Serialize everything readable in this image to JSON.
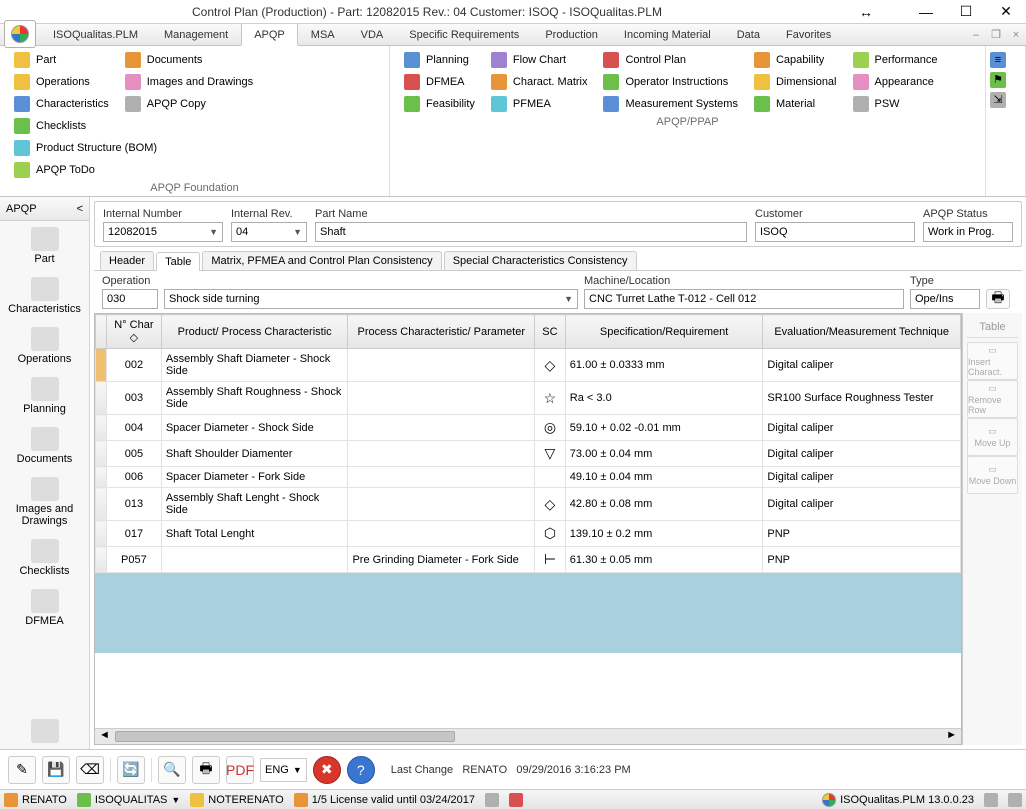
{
  "title": "Control Plan (Production) - Part: 12082015 Rev.: 04 Customer: ISOQ - ISOQualitas.PLM",
  "menu": {
    "tabs": [
      "ISOQualitas.PLM",
      "Management",
      "APQP",
      "MSA",
      "VDA",
      "Specific Requirements",
      "Production",
      "Incoming Material",
      "Data",
      "Favorites"
    ],
    "active": "APQP"
  },
  "ribbon": {
    "group1": {
      "label": "APQP Foundation",
      "col1": [
        {
          "icon": "gear",
          "label": "Part"
        },
        {
          "icon": "gear",
          "label": "Operations"
        },
        {
          "icon": "list",
          "label": "Characteristics"
        }
      ],
      "col2": [
        {
          "icon": "folder",
          "label": "Documents"
        },
        {
          "icon": "image",
          "label": "Images and Drawings"
        },
        {
          "icon": "copy",
          "label": "APQP Copy"
        }
      ],
      "col3": [
        {
          "icon": "check",
          "label": "Checklists"
        },
        {
          "icon": "tree",
          "label": "Product Structure (BOM)"
        },
        {
          "icon": "todo",
          "label": "APQP ToDo"
        }
      ]
    },
    "group2": {
      "label": "APQP/PPAP",
      "col1": [
        {
          "icon": "plan",
          "label": "Planning"
        },
        {
          "icon": "dfmea",
          "label": "DFMEA"
        },
        {
          "icon": "feas",
          "label": "Feasibility"
        }
      ],
      "col2": [
        {
          "icon": "flow",
          "label": "Flow Chart"
        },
        {
          "icon": "cm",
          "label": "Charact. Matrix"
        },
        {
          "icon": "pfmea",
          "label": "PFMEA"
        }
      ],
      "col3": [
        {
          "icon": "cp",
          "label": "Control Plan"
        },
        {
          "icon": "oi",
          "label": "Operator Instructions"
        },
        {
          "icon": "ms",
          "label": "Measurement Systems"
        }
      ],
      "col4": [
        {
          "icon": "cap",
          "label": "Capability"
        },
        {
          "icon": "dim",
          "label": "Dimensional"
        },
        {
          "icon": "mat",
          "label": "Material"
        }
      ],
      "col5": [
        {
          "icon": "perf",
          "label": "Performance"
        },
        {
          "icon": "app",
          "label": "Appearance"
        },
        {
          "icon": "psw",
          "label": "PSW"
        }
      ]
    }
  },
  "left_strip": {
    "header": "APQP",
    "items": [
      "Part",
      "Characteristics",
      "Operations",
      "Planning",
      "Documents",
      "Images and Drawings",
      "Checklists",
      "DFMEA"
    ]
  },
  "fields": {
    "internal_number": {
      "label": "Internal Number",
      "value": "12082015"
    },
    "internal_rev": {
      "label": "Internal Rev.",
      "value": "04"
    },
    "part_name": {
      "label": "Part Name",
      "value": "Shaft"
    },
    "customer": {
      "label": "Customer",
      "value": "ISOQ"
    },
    "apqp_status": {
      "label": "APQP Status",
      "value": "Work in Prog."
    }
  },
  "content_tabs": [
    "Header",
    "Table",
    "Matrix, PFMEA and Control Plan Consistency",
    "Special Characteristics Consistency"
  ],
  "content_active": "Table",
  "filter": {
    "operation": {
      "label": "Operation",
      "code": "030",
      "desc": "Shock side turning"
    },
    "machine": {
      "label": "Machine/Location",
      "value": "CNC Turret Lathe  T-012 -  Cell 012"
    },
    "type": {
      "label": "Type",
      "value": "Ope/Ins"
    }
  },
  "table": {
    "columns": [
      "",
      "N° Char ◇",
      "Product/ Process Characteristic",
      "Process Characteristic/ Parameter",
      "SC",
      "Specification/Requirement",
      "Evaluation/Measurement Technique"
    ],
    "rows": [
      {
        "sel": true,
        "nchar": "002",
        "prod": "Assembly Shaft Diameter - Shock Side",
        "param": "",
        "sc": "◇",
        "spec": "61.00  ± 0.0333 mm",
        "eval": "Digital caliper"
      },
      {
        "nchar": "003",
        "prod": "Assembly Shaft Roughness - Shock Side",
        "param": "",
        "sc": "☆",
        "spec": "Ra < 3.0",
        "eval": "SR100 Surface Roughness Tester"
      },
      {
        "nchar": "004",
        "prod": "Spacer Diameter - Shock Side",
        "param": "",
        "sc": "◎",
        "spec": "59.10  + 0.02 -0.01 mm",
        "eval": "Digital caliper"
      },
      {
        "nchar": "005",
        "prod": "Shaft Shoulder Diamenter",
        "param": "",
        "sc": "▽",
        "spec": "73.00  ± 0.04 mm",
        "eval": "Digital caliper"
      },
      {
        "nchar": "006",
        "prod": "Spacer Diameter - Fork Side",
        "param": "",
        "sc": "",
        "spec": "49.10  ± 0.04 mm",
        "eval": "Digital caliper"
      },
      {
        "nchar": "013",
        "prod": "Assembly Shaft Lenght - Shock Side",
        "param": "",
        "sc": "◇",
        "spec": "42.80  ± 0.08 mm",
        "eval": "Digital caliper"
      },
      {
        "nchar": "017",
        "prod": "Shaft Total Lenght",
        "param": "",
        "sc": "⬡",
        "spec": "139.10 ± 0.2 mm",
        "eval": "PNP"
      },
      {
        "nchar": "P057",
        "prod": "",
        "param": "Pre Grinding Diameter - Fork Side",
        "sc": "⊢",
        "spec": "61.30  ± 0.05 mm",
        "eval": "PNP"
      }
    ]
  },
  "right_actions": {
    "header": "Table",
    "items": [
      "Insert Charact.",
      "Remove Row",
      "Move Up",
      "Move Down"
    ]
  },
  "bottom_toolbar": {
    "lang": "ENG",
    "last_change_label": "Last Change",
    "last_change_user": "RENATO",
    "last_change_ts": "09/29/2016 3:16:23 PM"
  },
  "status": {
    "user": "RENATO",
    "company": "ISOQUALITAS",
    "notebook": "NOTERENATO",
    "license": "1/5 License valid until 03/24/2017",
    "version": "ISOQualitas.PLM 13.0.0.23"
  }
}
